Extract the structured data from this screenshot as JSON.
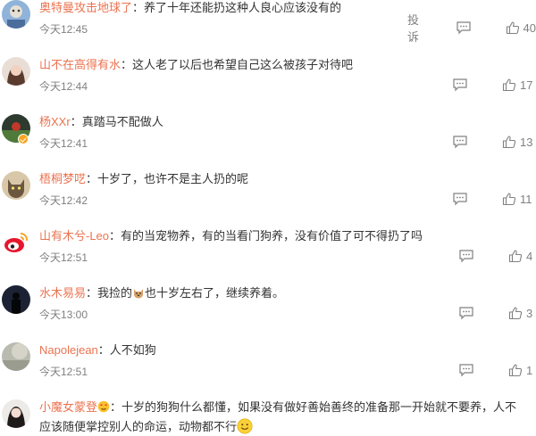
{
  "report_label": "投诉",
  "comments": [
    {
      "user": "奥特曼攻击地球了",
      "text": "养了十年还能扔这种人良心应该没有的",
      "time": "今天12:45",
      "likes": "40"
    },
    {
      "user": "山不在高得有水",
      "text": "这人老了以后也希望自己这么被孩子对待吧",
      "time": "今天12:44",
      "likes": "17"
    },
    {
      "user": "杨XXr",
      "text": "真踏马不配做人",
      "time": "今天12:41",
      "likes": "13"
    },
    {
      "user": "梧桐梦呓",
      "text": "十岁了，也许不是主人扔的呢",
      "time": "今天12:42",
      "likes": "11"
    },
    {
      "user": "山有木兮-Leo",
      "text": "有的当宠物养，有的当看门狗养，没有价值了可不得扔了吗",
      "time": "今天12:51",
      "likes": "4"
    },
    {
      "user": "水木易易",
      "text_before": "我捡的",
      "text_after": "也十岁左右了，继续养着。",
      "time": "今天13:00",
      "likes": "3"
    },
    {
      "user": "Napolejean",
      "text": "人不如狗",
      "time": "今天12:51",
      "likes": "1"
    },
    {
      "user": "小魔女蒙登",
      "text": "十岁的狗狗什么都懂，如果没有做好善始善终的准备那一开始就不要养，人不应该随便掌控别人的命运，动物都不行"
    }
  ]
}
